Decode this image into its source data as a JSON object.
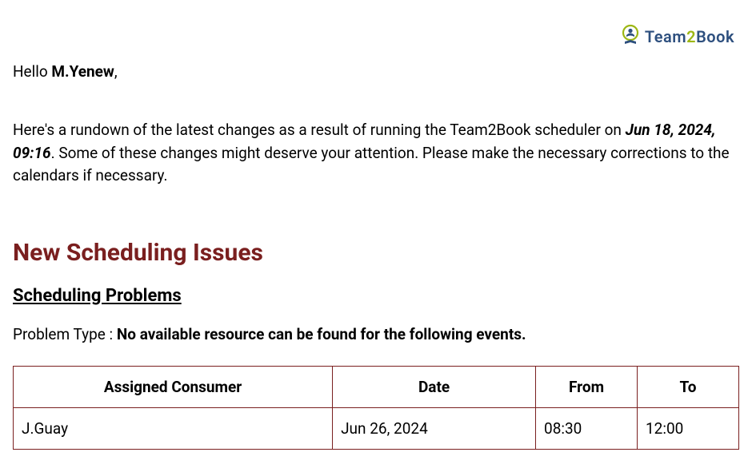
{
  "brand": {
    "part1": "Team",
    "part2": "2",
    "part3": "Book"
  },
  "greeting": {
    "prefix": "Hello ",
    "name": "M.Yenew",
    "suffix": ","
  },
  "intro": {
    "before": "Here's a rundown of the latest changes as a result of running the Team2Book scheduler on ",
    "run_time": "Jun 18, 2024, 09:16",
    "after": ". Some of these changes might deserve your attention. Please make the necessary corrections to the calendars if necessary."
  },
  "section_title": "New Scheduling Issues",
  "subsection_title": "Scheduling Problems",
  "problem": {
    "label": "Problem Type : ",
    "value": "No available resource can be found for the following events."
  },
  "table": {
    "headers": {
      "consumer": "Assigned Consumer",
      "date": "Date",
      "from": "From",
      "to": "To"
    },
    "rows": [
      {
        "consumer": "J.Guay",
        "date": "Jun 26, 2024",
        "from": "08:30",
        "to": "12:00"
      }
    ]
  }
}
